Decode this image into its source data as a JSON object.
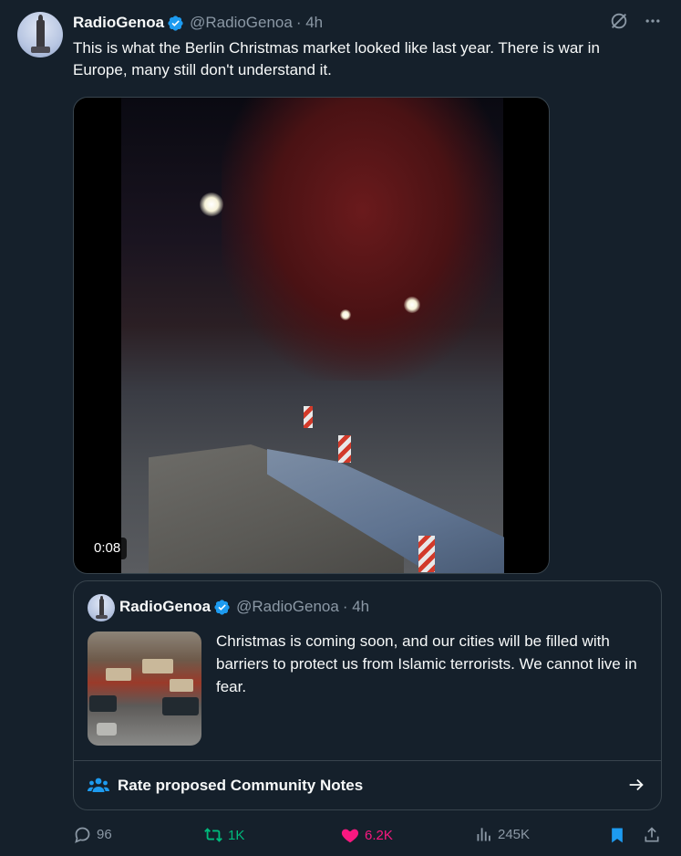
{
  "tweet": {
    "author_name": "RadioGenoa",
    "handle": "@RadioGenoa",
    "time": "· 4h",
    "text": "This is what the Berlin Christmas market looked like last year. There is war in Europe, many still don't understand it.",
    "video_duration": "0:08"
  },
  "quoted_tweet": {
    "author_name": "RadioGenoa",
    "handle": "@RadioGenoa",
    "time": "· 4h",
    "text": "Christmas is coming soon, and our cities will be filled with barriers to protect us from Islamic terrorists. We cannot live in fear."
  },
  "community_notes": {
    "label": "Rate proposed Community Notes"
  },
  "engagement": {
    "replies": "96",
    "reposts": "1K",
    "likes": "6.2K",
    "views": "245K"
  },
  "colors": {
    "background": "#15202b",
    "verified": "#1d9bf0",
    "repost_active": "#00ba7c",
    "like_active": "#f91880",
    "muted_text": "#8b98a5"
  },
  "icons": [
    "verified-badge-icon",
    "grok-icon",
    "more-icon",
    "play-video",
    "people-icon",
    "arrow-right-icon",
    "reply-icon",
    "repost-icon",
    "like-icon",
    "views-icon",
    "bookmark-icon",
    "share-icon"
  ]
}
